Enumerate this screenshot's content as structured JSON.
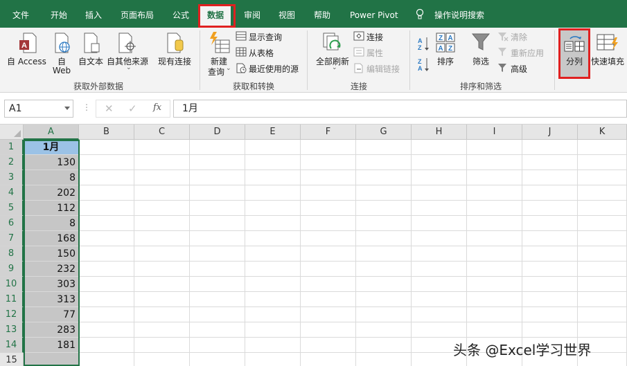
{
  "tabs": [
    "文件",
    "开始",
    "插入",
    "页面布局",
    "公式",
    "数据",
    "审阅",
    "视图",
    "帮助",
    "Power Pivot"
  ],
  "active_tab": "数据",
  "tell_me": "操作说明搜索",
  "ribbon": {
    "get_external": {
      "label": "获取外部数据",
      "access": "自 Access",
      "web_line1": "自",
      "web_line2": "Web",
      "text": "自文本",
      "other": "自其他来源",
      "existing": "现有连接"
    },
    "get_transform": {
      "label": "获取和转换",
      "new_query_line1": "新建",
      "new_query_line2": "查询",
      "show_queries": "显示查询",
      "from_table": "从表格",
      "recent_sources": "最近使用的源"
    },
    "connections": {
      "label": "连接",
      "refresh_all": "全部刷新",
      "connections": "连接",
      "properties": "属性",
      "edit_links": "编辑链接"
    },
    "sort_filter": {
      "label": "排序和筛选",
      "sort": "排序",
      "filter": "筛选",
      "clear": "清除",
      "reapply": "重新应用",
      "advanced": "高级"
    },
    "data_tools": {
      "text_to_columns": "分列",
      "flash_fill": "快速填充"
    }
  },
  "formula_bar": {
    "name_box": "A1",
    "fx": "fx",
    "value": "1月"
  },
  "columns": [
    "A",
    "B",
    "C",
    "D",
    "E",
    "F",
    "G",
    "H",
    "I",
    "J",
    "K"
  ],
  "rows": [
    "1",
    "2",
    "3",
    "4",
    "5",
    "6",
    "7",
    "8",
    "9",
    "10",
    "11",
    "12",
    "13",
    "14",
    "15"
  ],
  "column_a": [
    "1月",
    "130",
    "8",
    "202",
    "112",
    "8",
    "168",
    "150",
    "232",
    "303",
    "313",
    "77",
    "283",
    "181",
    ""
  ],
  "watermark": "头条 @Excel学习世界",
  "colors": {
    "excel_green": "#217346",
    "highlight_red": "#e02020",
    "header_fill": "#9bc2e6",
    "selection_fill": "#c6c6c6"
  }
}
